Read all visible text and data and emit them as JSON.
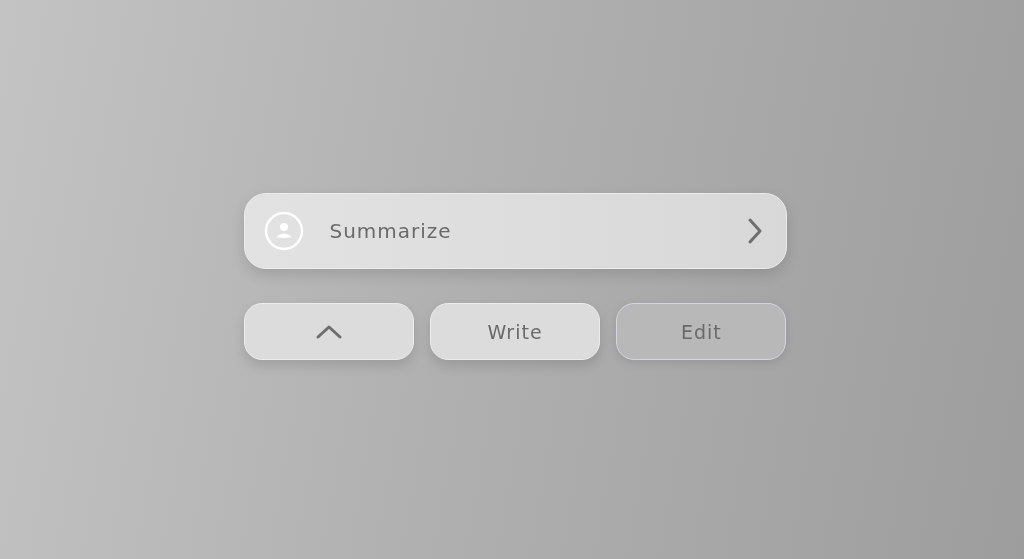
{
  "main_button": {
    "label": "Summarize"
  },
  "buttons": [
    {
      "kind": "icon",
      "pressed": false
    },
    {
      "kind": "text",
      "label": "Write",
      "pressed": false
    },
    {
      "kind": "text",
      "label": "Edit",
      "pressed": true
    }
  ]
}
